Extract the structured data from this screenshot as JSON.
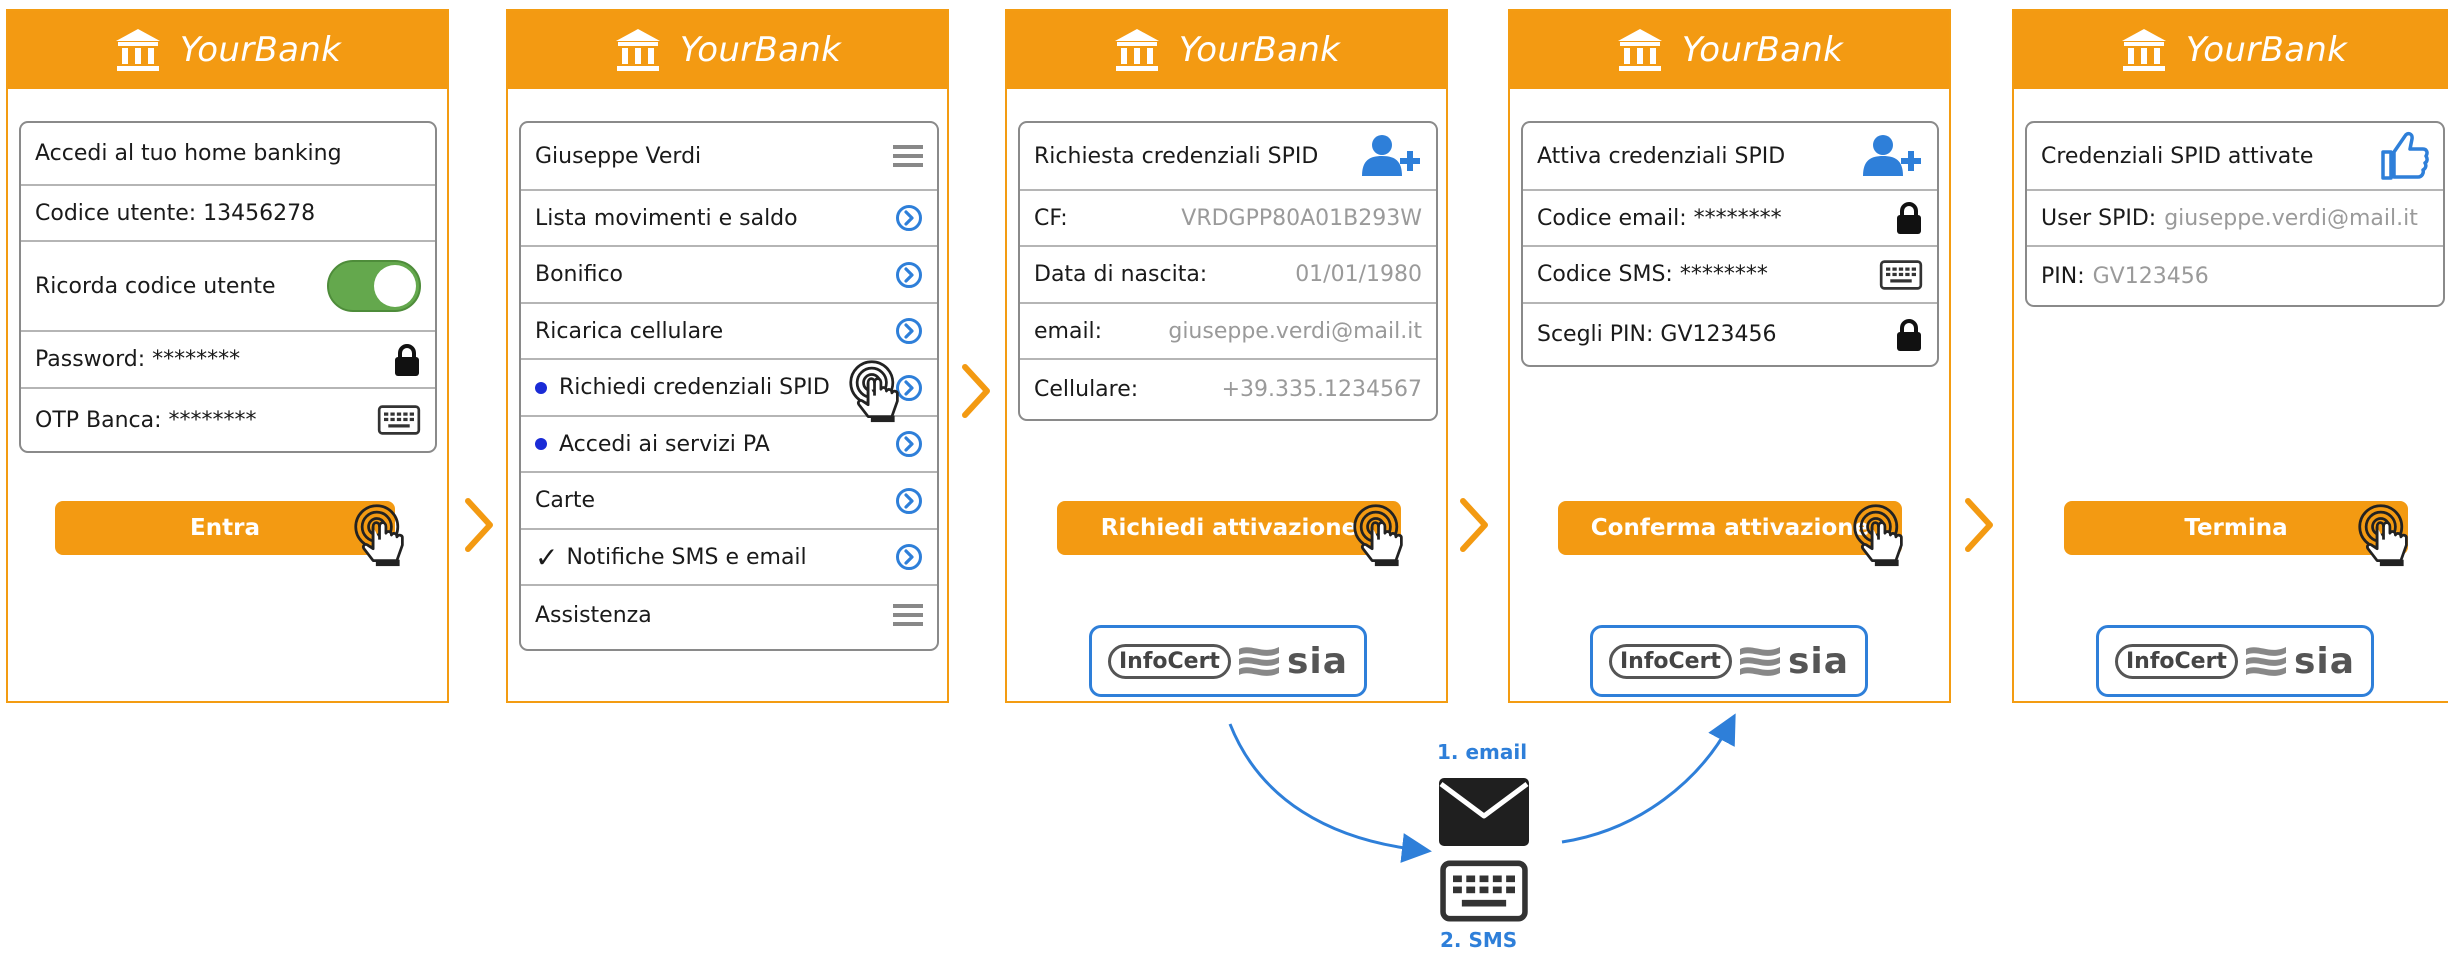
{
  "bank_name": "YourBank",
  "screen1": {
    "rows": [
      "Accedi al tuo home banking",
      "Codice utente: 13456278",
      "Ricorda codice utente",
      "Password: ********",
      "OTP Banca: ********"
    ],
    "button": "Entra"
  },
  "screen2": {
    "rows": [
      "Giuseppe Verdi",
      "Lista movimenti e saldo",
      "Bonifico",
      "Ricarica cellulare",
      "Richiedi credenziali SPID",
      "Accedi ai servizi PA",
      "Carte",
      "Notifiche SMS e email",
      "Assistenza"
    ]
  },
  "screen3": {
    "title": "Richiesta credenziali SPID",
    "fields": [
      {
        "label": "CF:",
        "value": "VRDGPP80A01B293W"
      },
      {
        "label": "Data di nascita:",
        "value": "01/01/1980"
      },
      {
        "label": "email:",
        "value": "giuseppe.verdi@mail.it"
      },
      {
        "label": "Cellulare:",
        "value": "+39.335.1234567"
      }
    ],
    "button": "Richiedi attivazione"
  },
  "screen4": {
    "title": "Attiva credenziali SPID",
    "rows": [
      "Codice email: ********",
      "Codice SMS: ********",
      "Scegli PIN: GV123456"
    ],
    "button": "Conferma attivazione"
  },
  "screen5": {
    "title": "Credenziali SPID attivate",
    "user_label": "User SPID:",
    "user_value": "giuseppe.verdi@mail.it",
    "pin_label": "PIN:",
    "pin_value": "GV123456",
    "button": "Termina"
  },
  "logos": {
    "infocert": "InfoCert",
    "sia": "sia"
  },
  "flow": {
    "step1": "1. email",
    "step2": "2. SMS"
  },
  "colors": {
    "orange": "#f39a12",
    "blue": "#2e7fd9",
    "toggle_green": "#64a84d",
    "dot_blue": "#1a2bd6"
  },
  "icons": [
    "bank-icon",
    "lock-icon",
    "keyboard-icon",
    "menu-icon",
    "chevron-circle-icon",
    "add-user-icon",
    "thumbs-up-icon",
    "tap-hand-icon",
    "envelope-icon",
    "arrow-right-icon"
  ]
}
